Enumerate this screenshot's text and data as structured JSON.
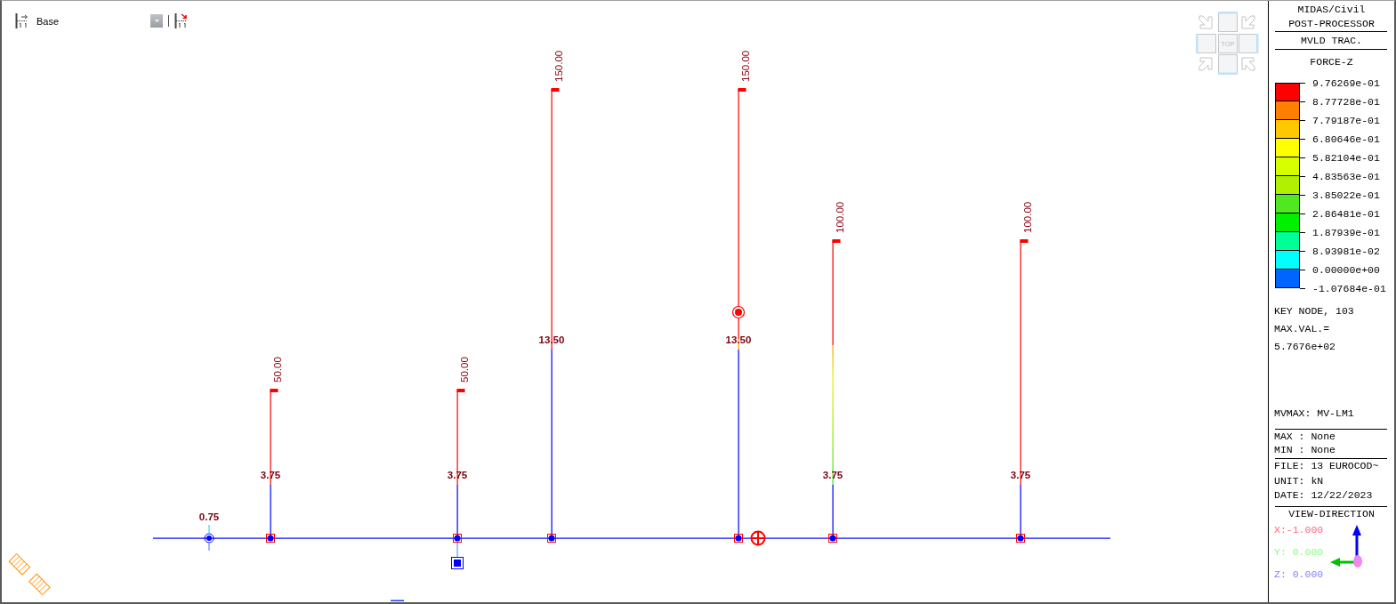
{
  "toolbar": {
    "layer": "Base"
  },
  "view_cube": {
    "face": "TOP"
  },
  "diagram": {
    "members": [
      {
        "kind": "point",
        "label": "0.75"
      },
      {
        "kind": "bar",
        "peak": "50.00",
        "label": "3.75"
      },
      {
        "kind": "bar",
        "peak": "50.00",
        "label": "3.75"
      },
      {
        "kind": "bar",
        "peak": "150.00",
        "label": "13.50"
      },
      {
        "kind": "bar",
        "peak": "150.00",
        "label": "13.50"
      },
      {
        "kind": "bar",
        "peak": "100.00",
        "label": "3.75"
      },
      {
        "kind": "bar",
        "peak": "100.00",
        "label": "3.75"
      }
    ]
  },
  "panel": {
    "header": [
      "MIDAS/Civil",
      "POST-PROCESSOR"
    ],
    "mode": "MVLD TRAC.",
    "component": "FORCE-Z",
    "legend": {
      "bands": [
        {
          "color": "#ff0000"
        },
        {
          "color": "#ff8000"
        },
        {
          "color": "#ffc800"
        },
        {
          "color": "#ffff00"
        },
        {
          "color": "#d8ff00"
        },
        {
          "color": "#b0f000"
        },
        {
          "color": "#50e820"
        },
        {
          "color": "#00f000"
        },
        {
          "color": "#00ff96"
        },
        {
          "color": "#00ffff"
        },
        {
          "color": "#0064ff"
        }
      ],
      "ticks": [
        "9.76269e-01",
        "8.77728e-01",
        "7.79187e-01",
        "6.80646e-01",
        "5.82104e-01",
        "4.83563e-01",
        "3.85022e-01",
        "2.86481e-01",
        "1.87939e-01",
        "8.93981e-02",
        "0.00000e+00",
        "-1.07684e-01"
      ]
    },
    "key_node": [
      "KEY NODE, 103",
      "MAX.VAL.=",
      "5.7676e+02"
    ],
    "mvmax": "MVMAX: MV-LM1",
    "limits": [
      "MAX : None",
      "MIN : None"
    ],
    "info": [
      "FILE: 13 EUROCOD~",
      "UNIT: kN",
      "DATE: 12/22/2023"
    ],
    "view_direction": {
      "title": "VIEW-DIRECTION",
      "axes": [
        {
          "text": "X:-1.000",
          "color": "#ff6680"
        },
        {
          "text": "Y: 0.000",
          "color": "#80ff80"
        },
        {
          "text": "Z: 0.000",
          "color": "#8080ff"
        }
      ]
    }
  }
}
